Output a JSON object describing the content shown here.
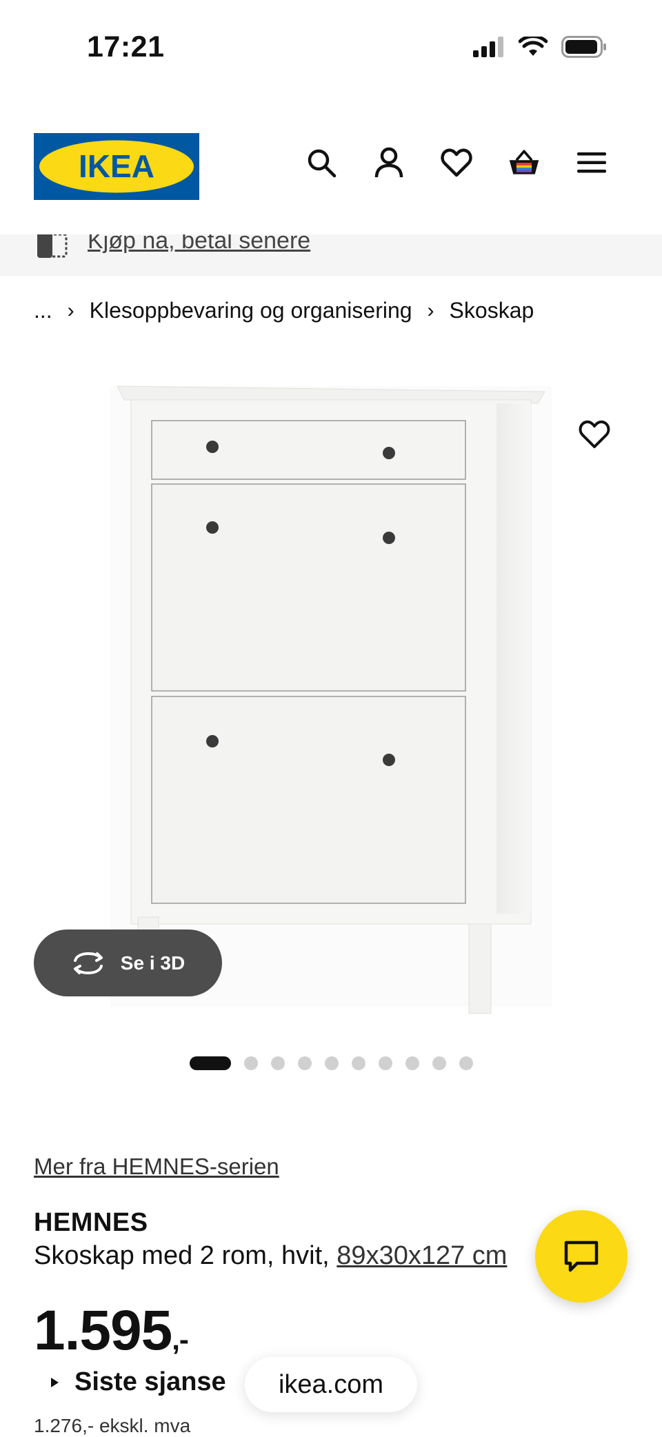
{
  "status_bar": {
    "time": "17:21"
  },
  "brand": {
    "logo_text": "IKEA",
    "primary_color": "#0058a3",
    "accent_color": "#fbd914"
  },
  "header": {
    "icons": [
      "search-icon",
      "account-icon",
      "heart-icon",
      "basket-icon",
      "menu-icon"
    ]
  },
  "promo": {
    "text": "Kjøp nå, betal senere"
  },
  "breadcrumb": {
    "ellipsis": "...",
    "items": [
      "Klesoppbevaring og organisering",
      "Skoskap"
    ]
  },
  "gallery": {
    "view_3d_label": "Se i 3D",
    "image_count": 10,
    "active_index": 0
  },
  "product": {
    "series_link": "Mer fra HEMNES-serien",
    "name": "HEMNES",
    "description": "Skoskap med 2 rom, hvit, ",
    "dimensions": "89x30x127 cm",
    "price_main": "1.595",
    "price_suffix": ",-",
    "last_chance": "Siste sjanse",
    "price_excl": "1.276,- ekskl. mva"
  },
  "browser": {
    "url": "ikea.com"
  }
}
